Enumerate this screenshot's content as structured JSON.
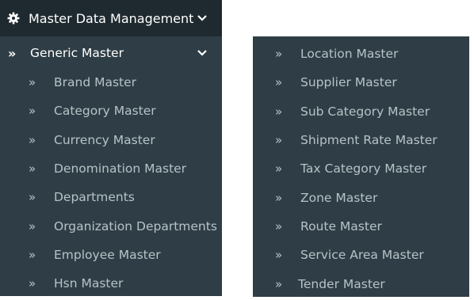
{
  "menu": {
    "header": {
      "title": "Master Data Management",
      "icon": "gear-icon",
      "chevron": "chevron-down-icon"
    },
    "group": {
      "label": "Generic Master",
      "icon": "double-chevron-right-icon",
      "chevron": "chevron-down-icon"
    },
    "left_items": [
      {
        "label": "Brand Master"
      },
      {
        "label": "Category Master"
      },
      {
        "label": "Currency Master"
      },
      {
        "label": "Denomination Master"
      },
      {
        "label": "Departments"
      },
      {
        "label": "Organization Departments"
      },
      {
        "label": "Employee Master"
      },
      {
        "label": "Hsn Master"
      }
    ],
    "right_items": [
      {
        "label": "Location Master"
      },
      {
        "label": "Supplier Master"
      },
      {
        "label": "Sub Category Master"
      },
      {
        "label": "Shipment Rate Master"
      },
      {
        "label": "Tax Category Master"
      },
      {
        "label": "Zone Master"
      },
      {
        "label": "Route Master"
      },
      {
        "label": "Service Area Master"
      },
      {
        "label": "Tender Master"
      }
    ]
  },
  "colors": {
    "panel_bg": "#2f3e46",
    "header_bg": "#1f2a30",
    "item_text": "#b7c2c7",
    "active_text": "#ffffff"
  }
}
